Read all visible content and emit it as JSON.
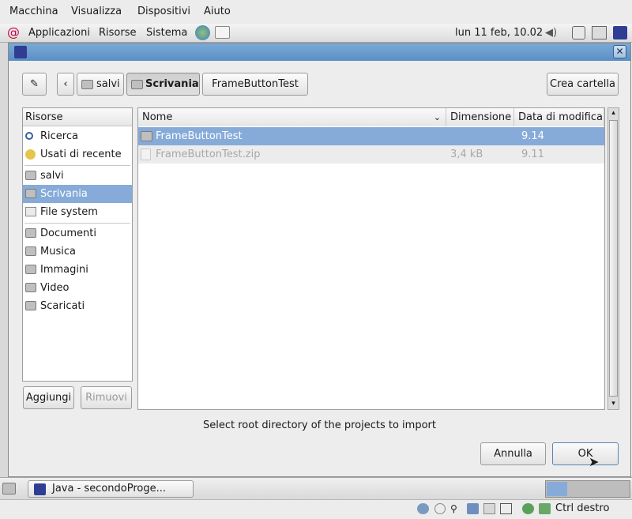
{
  "vbox_menu": [
    "Macchina",
    "Visualizza",
    "Dispositivi",
    "Aiuto"
  ],
  "panel": {
    "apps": "Applicazioni",
    "places": "Risorse",
    "system": "Sistema",
    "clock": "lun 11 feb, 10.02"
  },
  "pathbar": {
    "home": "salvi",
    "current": "Scrivania",
    "child": "FrameButtonTest",
    "create_folder": "Crea cartella"
  },
  "places_header": "Risorse",
  "places": [
    "Ricerca",
    "Usati di recente",
    "salvi",
    "Scrivania",
    "File system",
    "Documenti",
    "Musica",
    "Immagini",
    "Video",
    "Scaricati"
  ],
  "places_buttons": {
    "add": "Aggiungi",
    "remove": "Rimuovi"
  },
  "columns": {
    "name": "Nome",
    "size": "Dimensione",
    "date": "Data di modifica"
  },
  "files": [
    {
      "name": "FrameButtonTest",
      "size": "",
      "date": "9.14"
    },
    {
      "name": "FrameButtonTest.zip",
      "size": "3,4 kB",
      "date": "9.11"
    }
  ],
  "message": "Select root directory of the projects to import",
  "buttons": {
    "cancel": "Annulla",
    "ok": "OK"
  },
  "taskbar": {
    "window": "Java - secondoProge..."
  },
  "status": {
    "host_key": "Ctrl destro"
  }
}
